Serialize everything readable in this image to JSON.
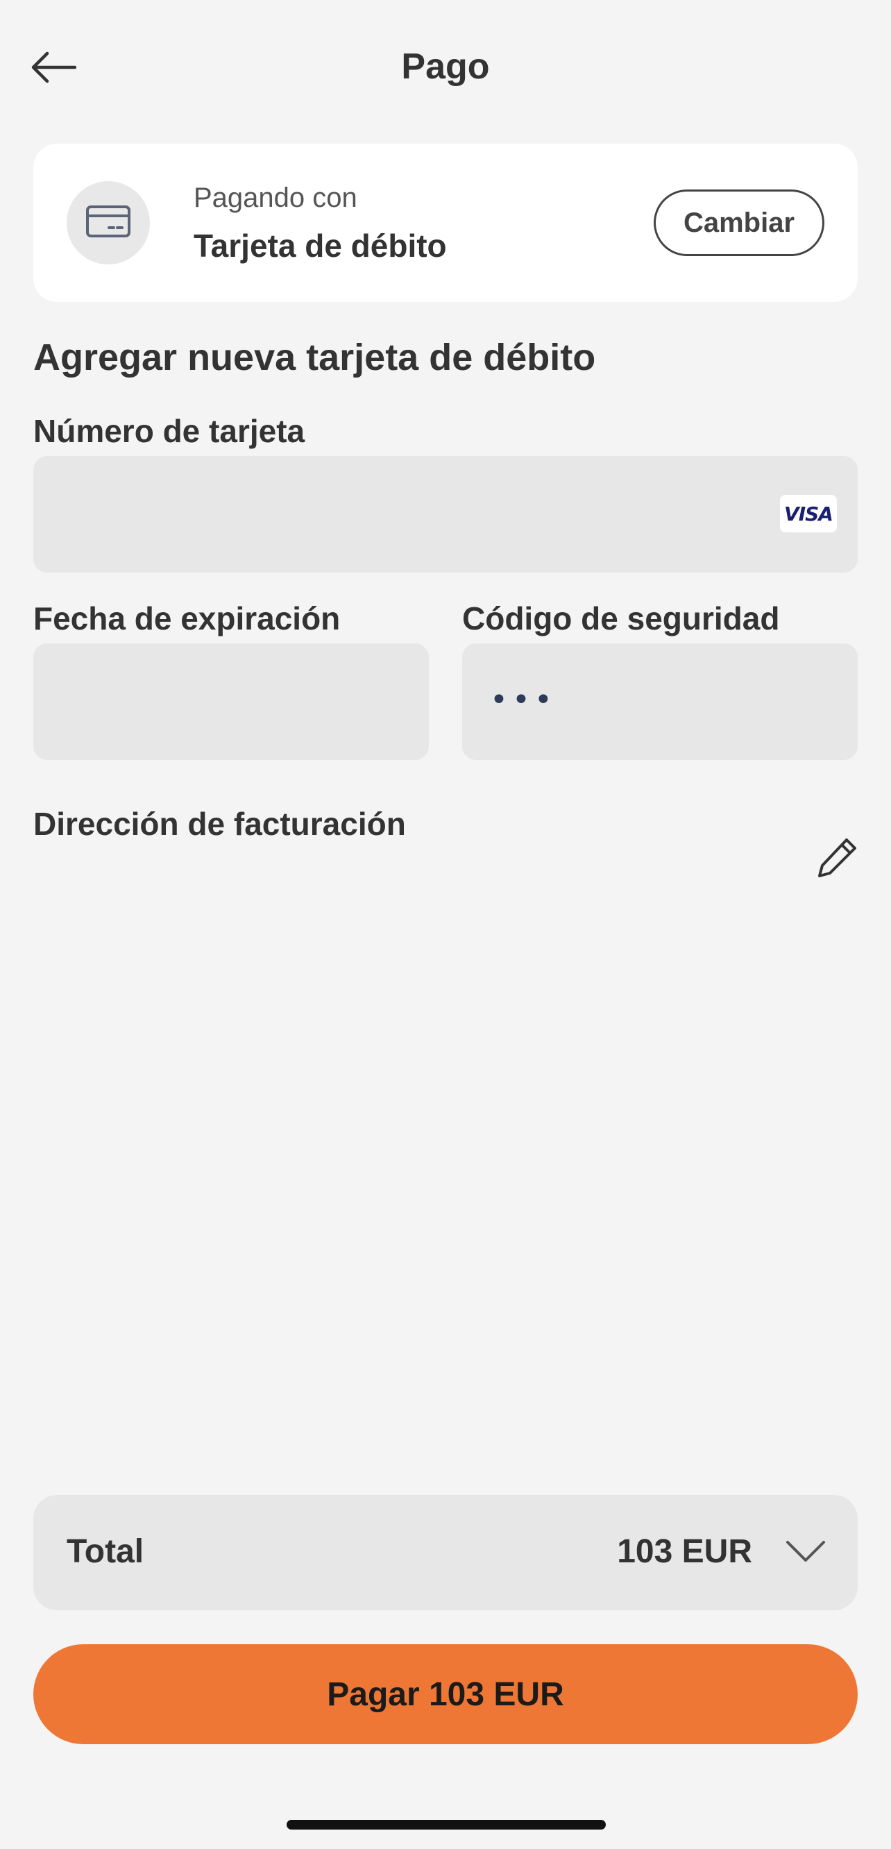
{
  "header": {
    "title": "Pago",
    "back_icon": "arrow-left-icon"
  },
  "payment_method": {
    "subtitle": "Pagando con",
    "name": "Tarjeta de débito",
    "icon": "credit-card-icon",
    "change_label": "Cambiar"
  },
  "card_form": {
    "section_title": "Agregar nueva tarjeta de débito",
    "card_number": {
      "label": "Número de tarjeta",
      "value": "",
      "brand": "VISA"
    },
    "expiration": {
      "label": "Fecha de expiración",
      "value": ""
    },
    "security_code": {
      "label": "Código de seguridad",
      "value": "•••"
    },
    "billing_address": {
      "label": "Dirección de facturación",
      "edit_icon": "pencil-icon"
    }
  },
  "summary": {
    "total_label": "Total",
    "total_amount": "103 EUR",
    "expand_icon": "chevron-down-icon",
    "pay_label": "Pagar 103 EUR"
  },
  "colors": {
    "background": "#f4f4f4",
    "card": "#ffffff",
    "field": "#e7e7e7",
    "accent": "#ee7735",
    "text": "#333333",
    "visa": "#1a1f71"
  }
}
